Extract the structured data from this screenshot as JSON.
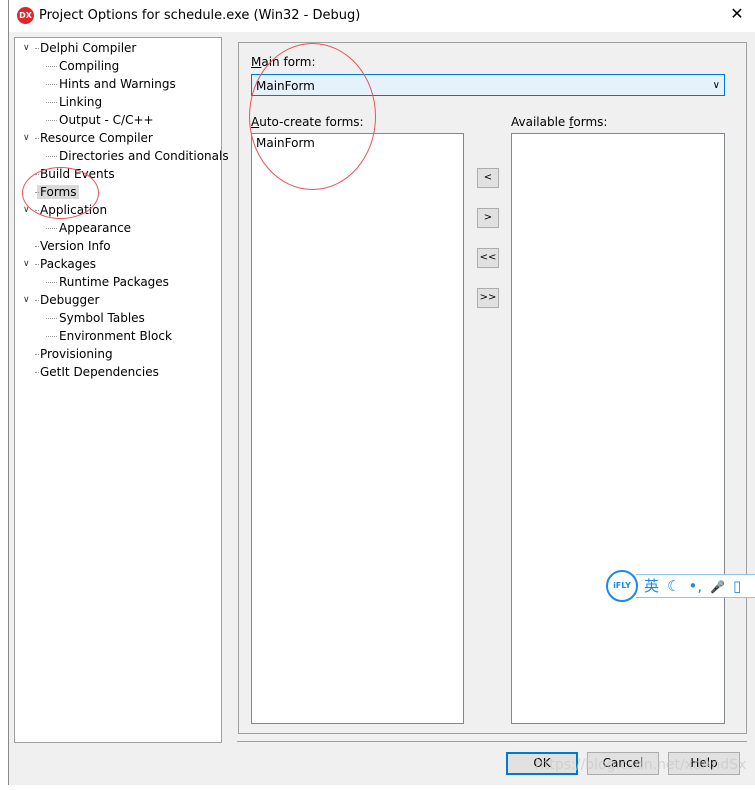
{
  "window": {
    "title": "Project Options for schedule.exe  (Win32 - Debug)",
    "logo": "DX",
    "close_icon": "✕"
  },
  "tree": [
    {
      "label": "Delphi Compiler",
      "level": 0,
      "expanded": true
    },
    {
      "label": "Compiling",
      "level": 1
    },
    {
      "label": "Hints and Warnings",
      "level": 1
    },
    {
      "label": "Linking",
      "level": 1
    },
    {
      "label": "Output - C/C++",
      "level": 1
    },
    {
      "label": "Resource Compiler",
      "level": 0,
      "expanded": true
    },
    {
      "label": "Directories and Conditionals",
      "level": 1
    },
    {
      "label": "Build Events",
      "level": 0
    },
    {
      "label": "Forms",
      "level": 0,
      "selected": true
    },
    {
      "label": "Application",
      "level": 0,
      "expanded": true
    },
    {
      "label": "Appearance",
      "level": 1
    },
    {
      "label": "Version Info",
      "level": 0
    },
    {
      "label": "Packages",
      "level": 0,
      "expanded": true
    },
    {
      "label": "Runtime Packages",
      "level": 1
    },
    {
      "label": "Debugger",
      "level": 0,
      "expanded": true
    },
    {
      "label": "Symbol Tables",
      "level": 1
    },
    {
      "label": "Environment Block",
      "level": 1
    },
    {
      "label": "Provisioning",
      "level": 0
    },
    {
      "label": "GetIt Dependencies",
      "level": 0
    }
  ],
  "forms": {
    "main_form_label_key": "M",
    "main_form_label_rest": "ain form:",
    "main_form_value": "MainForm",
    "auto_label_key": "A",
    "auto_label_rest": "uto-create forms:",
    "auto_items": [
      "MainForm"
    ],
    "available_label_pre": "Available ",
    "available_label_key": "f",
    "available_label_rest": "orms:",
    "available_items": [],
    "move_buttons": [
      "<",
      ">",
      "<<",
      ">>"
    ]
  },
  "buttons": {
    "ok": "OK",
    "cancel": "Cancel",
    "help": "Help"
  },
  "ifly": {
    "logo": "iFLY",
    "items": [
      "英",
      "☾",
      "•,",
      "🎤",
      "▯"
    ]
  },
  "watermark": "https://blog.csdn.net/xdAndSx",
  "colors": {
    "accent": "#0078d7",
    "annotation": "#e85555"
  }
}
